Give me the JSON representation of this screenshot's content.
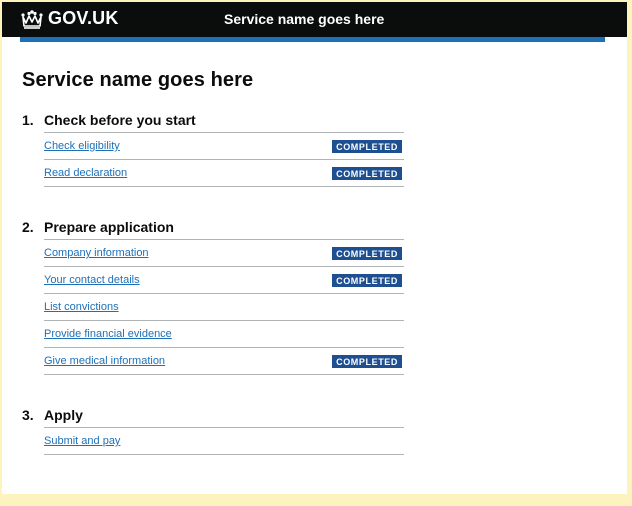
{
  "header": {
    "logo_text": "GOV.UK",
    "service_name": "Service name goes here"
  },
  "page": {
    "title": "Service name goes here"
  },
  "colors": {
    "header_bg": "#0b0c0c",
    "blue_bar": "#1d70b8",
    "link": "#1d70b8",
    "tag_bg": "#1d4f91",
    "outer_bg": "#fdf3bf"
  },
  "sections": [
    {
      "number": "1.",
      "title": "Check before you start",
      "tasks": [
        {
          "label": "Check eligibility",
          "status": "COMPLETED"
        },
        {
          "label": "Read declaration",
          "status": "COMPLETED"
        }
      ]
    },
    {
      "number": "2.",
      "title": "Prepare application",
      "tasks": [
        {
          "label": "Company information",
          "status": "COMPLETED"
        },
        {
          "label": "Your contact details",
          "status": "COMPLETED"
        },
        {
          "label": "List convictions",
          "status": ""
        },
        {
          "label": "Provide financial evidence",
          "status": ""
        },
        {
          "label": "Give medical information",
          "status": "COMPLETED"
        }
      ]
    },
    {
      "number": "3.",
      "title": "Apply",
      "tasks": [
        {
          "label": "Submit and pay",
          "status": ""
        }
      ]
    }
  ]
}
